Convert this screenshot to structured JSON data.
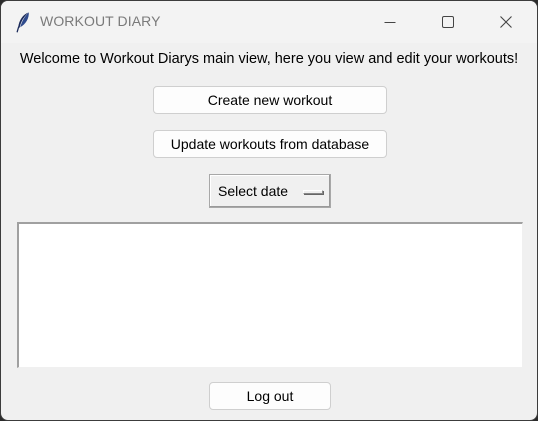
{
  "window": {
    "title": "WORKOUT DIARY",
    "app_icon": "feather-icon",
    "controls": {
      "minimize_icon": "minimize-icon",
      "maximize_icon": "maximize-icon",
      "close_icon": "close-icon"
    }
  },
  "main": {
    "welcome_text": "Welcome to Workout Diarys main view, here you view and edit your workouts!",
    "create_button_label": "Create new workout",
    "update_button_label": "Update workouts from database",
    "date_select": {
      "selected_value": "Select date"
    },
    "workout_list": {
      "items": []
    },
    "logout_button_label": "Log out"
  }
}
